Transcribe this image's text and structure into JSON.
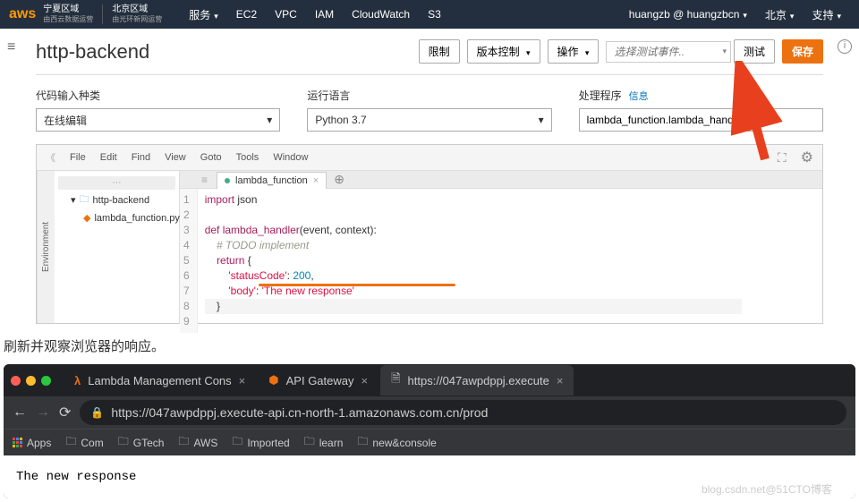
{
  "header": {
    "region1": "宁夏区域",
    "region1_sub": "由西云数据运营",
    "region2": "北京区域",
    "region2_sub": "由光环新网运营",
    "nav": {
      "services": "服务",
      "ec2": "EC2",
      "vpc": "VPC",
      "iam": "IAM",
      "cloudwatch": "CloudWatch",
      "s3": "S3"
    },
    "user": "huangzb @ huangzbcn",
    "region_sel": "北京",
    "support": "支持"
  },
  "lambda": {
    "title": "http-backend",
    "actions": {
      "limit": "限制",
      "version": "版本控制",
      "operate": "操作",
      "test": "测试",
      "save": "保存"
    },
    "event_placeholder": "选择测试事件..",
    "config": {
      "code_type_label": "代码输入种类",
      "code_type_value": "在线编辑",
      "runtime_label": "运行语言",
      "runtime_value": "Python 3.7",
      "handler_label": "处理程序",
      "handler_link": "信息",
      "handler_value": "lambda_function.lambda_handler"
    },
    "editor_menu": {
      "file": "File",
      "edit": "Edit",
      "find": "Find",
      "view": "View",
      "goto": "Goto",
      "tools": "Tools",
      "window": "Window"
    },
    "env_tab": "Environment",
    "tree": {
      "root": "http-backend",
      "file": "lambda_function.py"
    },
    "tab_name": "lambda_function",
    "code_lines": [
      "1",
      "2",
      "3",
      "4",
      "5",
      "6",
      "7",
      "8",
      "9"
    ]
  },
  "instruction_text": "刷新并观察浏览器的响应。",
  "browser": {
    "tabs": [
      {
        "icon": "lambda",
        "label": "Lambda Management Cons"
      },
      {
        "icon": "api",
        "label": "API Gateway"
      },
      {
        "icon": "page",
        "label": "https://047awpdppj.execute"
      }
    ],
    "url": "https://047awpdppj.execute-api.cn-north-1.amazonaws.com.cn/prod",
    "bookmarks": {
      "apps": "Apps",
      "com": "Com",
      "gtech": "GTech",
      "aws": "AWS",
      "imported": "Imported",
      "learn": "learn",
      "newconsole": "new&console"
    },
    "response": "The new response"
  },
  "watermark": "blog.csdn.net@51CTO博客"
}
